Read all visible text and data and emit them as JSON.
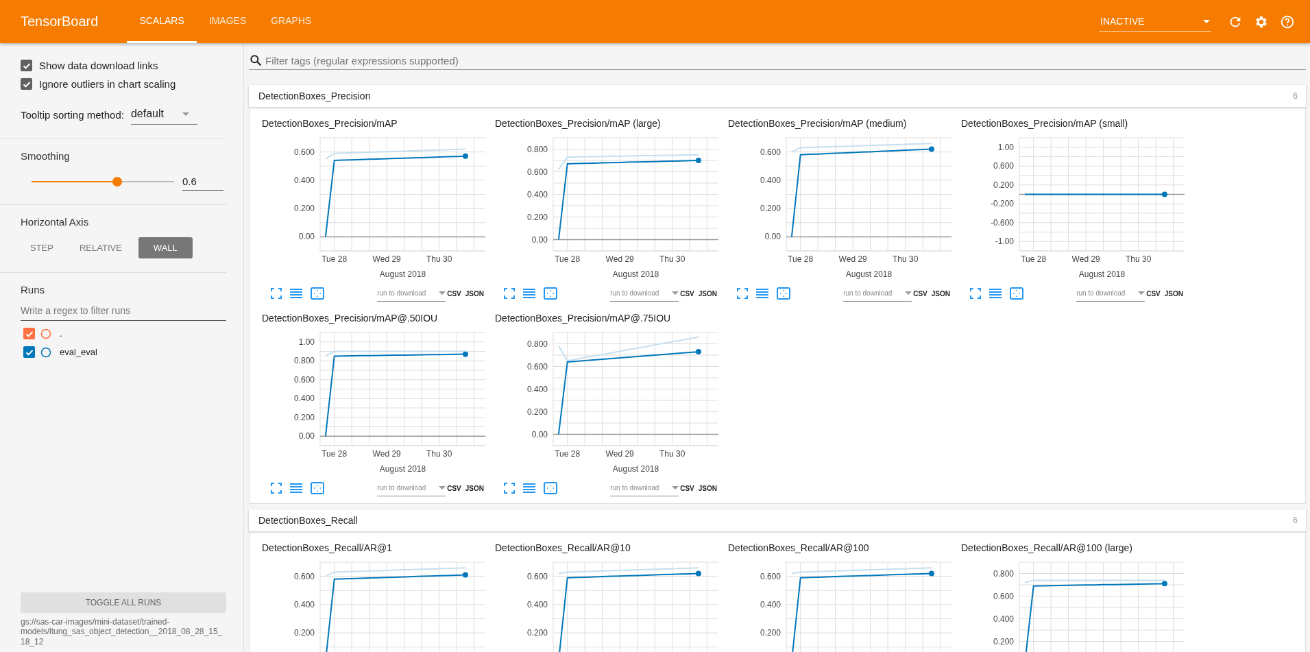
{
  "header": {
    "title": "TensorBoard",
    "tabs": [
      {
        "label": "SCALARS",
        "selected": true
      },
      {
        "label": "IMAGES",
        "selected": false
      },
      {
        "label": "GRAPHS",
        "selected": false
      }
    ],
    "run_status": {
      "value": "INACTIVE"
    }
  },
  "sidebar": {
    "options": [
      {
        "label": "Show data download links",
        "checked": true
      },
      {
        "label": "Ignore outliers in chart scaling",
        "checked": true
      }
    ],
    "tooltip_sorting": {
      "label": "Tooltip sorting method:",
      "value": "default"
    },
    "smoothing": {
      "label": "Smoothing",
      "level": 0.6,
      "reading": "0.6"
    },
    "horizontal_axis": {
      "label": "Horizontal Axis",
      "options": [
        {
          "label": "STEP",
          "selected": false
        },
        {
          "label": "RELATIVE",
          "selected": false
        },
        {
          "label": "WALL",
          "selected": true
        }
      ]
    },
    "runs": {
      "label": "Runs",
      "filter": {
        "placeholder": "Write a regex to filter runs"
      },
      "items": [
        {
          "label": ".",
          "checked": true,
          "color": "#ff7043"
        },
        {
          "label": "eval_eval",
          "checked": true,
          "color": "#0077bb"
        }
      ]
    },
    "toggle_button": "TOGGLE ALL RUNS",
    "log_dir": "gs://sas-car-images/mini-dataset/trained-models/ltung_sas_object_detection__2018_08_28_15_18_12"
  },
  "filter": {
    "placeholder": "Filter tags (regular expressions supported)"
  },
  "sections": [
    {
      "title": "DetectionBoxes_Precision",
      "count": "6",
      "cards": [
        {
          "title": "DetectionBoxes_Precision/mAP",
          "download": {
            "placeholder": "run to download",
            "links": [
              "CSV",
              "JSON"
            ]
          },
          "chart_data": {
            "type": "line",
            "grid": true,
            "xlabel": "August 2018",
            "categories": [
              null,
              "Tue 28",
              null,
              null,
              null,
              null,
              null,
              "Wed 29",
              null,
              null,
              null,
              null,
              null,
              "Thu 30",
              null,
              null,
              null
            ],
            "ylim": [
              -0.1,
              0.7
            ],
            "yticks": [
              {
                "value": 0,
                "label": "0.00"
              },
              {
                "value": 0.2,
                "label": "0.200"
              },
              {
                "value": 0.4,
                "label": "0.400"
              },
              {
                "value": 0.6,
                "label": "0.600"
              }
            ],
            "series": [
              {
                "color": "#c6dff0",
                "values": [
                  0.55,
                  0.59,
                  0.592,
                  0.594,
                  0.596,
                  0.598,
                  0.6,
                  0.602,
                  0.604,
                  0.606,
                  0.608,
                  0.61,
                  0.612,
                  0.614,
                  0.616,
                  0.618,
                  0.62
                ]
              },
              {
                "color": "#0077bb",
                "values": [
                  0,
                  0.54,
                  0.542,
                  0.544,
                  0.546,
                  0.548,
                  0.55,
                  0.552,
                  0.554,
                  0.556,
                  0.558,
                  0.56,
                  0.562,
                  0.564,
                  0.566,
                  0.568,
                  0.57
                ]
              }
            ]
          }
        },
        {
          "title": "DetectionBoxes_Precision/mAP (large)",
          "download": {
            "placeholder": "run to download",
            "links": [
              "CSV",
              "JSON"
            ]
          },
          "chart_data": {
            "type": "line",
            "grid": true,
            "xlabel": "August 2018",
            "categories": [
              null,
              "Tue 28",
              null,
              null,
              null,
              null,
              null,
              "Wed 29",
              null,
              null,
              null,
              null,
              null,
              "Thu 30",
              null,
              null,
              null
            ],
            "ylim": [
              -0.1,
              0.9
            ],
            "yticks": [
              {
                "value": 0,
                "label": "0.00"
              },
              {
                "value": 0.2,
                "label": "0.200"
              },
              {
                "value": 0.4,
                "label": "0.400"
              },
              {
                "value": 0.6,
                "label": "0.600"
              },
              {
                "value": 0.8,
                "label": "0.800"
              }
            ],
            "series": [
              {
                "color": "#c6dff0",
                "values": [
                  0.62,
                  0.73,
                  0.731,
                  0.733,
                  0.734,
                  0.735,
                  0.737,
                  0.738,
                  0.739,
                  0.741,
                  0.742,
                  0.743,
                  0.745,
                  0.746,
                  0.747,
                  0.749,
                  0.75
                ]
              },
              {
                "color": "#0077bb",
                "values": [
                  0,
                  0.67,
                  0.672,
                  0.674,
                  0.676,
                  0.678,
                  0.68,
                  0.682,
                  0.684,
                  0.686,
                  0.688,
                  0.69,
                  0.692,
                  0.694,
                  0.696,
                  0.698,
                  0.7
                ]
              }
            ]
          }
        },
        {
          "title": "DetectionBoxes_Precision/mAP (medium)",
          "download": {
            "placeholder": "run to download",
            "links": [
              "CSV",
              "JSON"
            ]
          },
          "chart_data": {
            "type": "line",
            "grid": true,
            "xlabel": "August 2018",
            "categories": [
              null,
              "Tue 28",
              null,
              null,
              null,
              null,
              null,
              "Wed 29",
              null,
              null,
              null,
              null,
              null,
              "Thu 30",
              null,
              null,
              null
            ],
            "ylim": [
              -0.1,
              0.7
            ],
            "yticks": [
              {
                "value": 0,
                "label": "0.00"
              },
              {
                "value": 0.2,
                "label": "0.200"
              },
              {
                "value": 0.4,
                "label": "0.400"
              },
              {
                "value": 0.6,
                "label": "0.600"
              }
            ],
            "series": [
              {
                "color": "#c6dff0",
                "values": [
                  0.6,
                  0.63,
                  0.632,
                  0.634,
                  0.636,
                  0.638,
                  0.64,
                  0.642,
                  0.644,
                  0.646,
                  0.648,
                  0.65,
                  0.652,
                  0.654,
                  0.656,
                  0.658,
                  0.66
                ]
              },
              {
                "color": "#0077bb",
                "values": [
                  0,
                  0.58,
                  0.583,
                  0.585,
                  0.588,
                  0.591,
                  0.593,
                  0.596,
                  0.599,
                  0.601,
                  0.604,
                  0.607,
                  0.609,
                  0.612,
                  0.615,
                  0.617,
                  0.62
                ]
              }
            ]
          }
        },
        {
          "title": "DetectionBoxes_Precision/mAP (small)",
          "download": {
            "placeholder": "run to download",
            "links": [
              "CSV",
              "JSON"
            ]
          },
          "chart_data": {
            "type": "line",
            "grid": true,
            "xlabel": "August 2018",
            "categories": [
              null,
              "Tue 28",
              null,
              null,
              null,
              null,
              null,
              "Wed 29",
              null,
              null,
              null,
              null,
              null,
              "Thu 30",
              null,
              null,
              null
            ],
            "ylim": [
              -1.2,
              1.2
            ],
            "yticks": [
              {
                "value": -1,
                "label": "-1.00"
              },
              {
                "value": -0.6,
                "label": "-0.600"
              },
              {
                "value": -0.2,
                "label": "-0.200"
              },
              {
                "value": 0.2,
                "label": "0.200"
              },
              {
                "value": 0.6,
                "label": "0.600"
              },
              {
                "value": 1,
                "label": "1.00"
              }
            ],
            "series": [
              {
                "color": "#c6dff0",
                "values": [
                  null,
                  null,
                  null,
                  null,
                  null,
                  null,
                  null,
                  null,
                  null,
                  null,
                  null,
                  null,
                  null,
                  null,
                  null,
                  null,
                  null
                ]
              },
              {
                "color": "#0077bb",
                "values": [
                  0,
                  0,
                  0,
                  0,
                  0,
                  0,
                  0,
                  0,
                  0,
                  0,
                  0,
                  0,
                  0,
                  0,
                  0,
                  0,
                  0
                ]
              }
            ]
          }
        },
        {
          "title": "DetectionBoxes_Precision/mAP@.50IOU",
          "download": {
            "placeholder": "run to download",
            "links": [
              "CSV",
              "JSON"
            ]
          },
          "chart_data": {
            "type": "line",
            "grid": true,
            "xlabel": "August 2018",
            "categories": [
              null,
              "Tue 28",
              null,
              null,
              null,
              null,
              null,
              "Wed 29",
              null,
              null,
              null,
              null,
              null,
              "Thu 30",
              null,
              null,
              null
            ],
            "ylim": [
              -0.1,
              1.1
            ],
            "yticks": [
              {
                "value": 0,
                "label": "0.00"
              },
              {
                "value": 0.2,
                "label": "0.200"
              },
              {
                "value": 0.4,
                "label": "0.400"
              },
              {
                "value": 0.6,
                "label": "0.600"
              },
              {
                "value": 0.8,
                "label": "0.800"
              },
              {
                "value": 1,
                "label": "1.00"
              }
            ],
            "series": [
              {
                "color": "#c6dff0",
                "values": [
                  0.85,
                  0.9,
                  0.9,
                  0.9,
                  0.9,
                  0.9,
                  0.9,
                  0.9,
                  0.9,
                  0.9,
                  0.9,
                  0.9,
                  0.9,
                  0.9,
                  0.9,
                  0.9,
                  0.9
                ]
              },
              {
                "color": "#0077bb",
                "values": [
                  0,
                  0.85,
                  0.851,
                  0.853,
                  0.854,
                  0.855,
                  0.857,
                  0.858,
                  0.859,
                  0.861,
                  0.862,
                  0.863,
                  0.865,
                  0.866,
                  0.867,
                  0.869,
                  0.87
                ]
              }
            ]
          }
        },
        {
          "title": "DetectionBoxes_Precision/mAP@.75IOU",
          "download": {
            "placeholder": "run to download",
            "links": [
              "CSV",
              "JSON"
            ]
          },
          "chart_data": {
            "type": "line",
            "grid": true,
            "xlabel": "August 2018",
            "categories": [
              null,
              "Tue 28",
              null,
              null,
              null,
              null,
              null,
              "Wed 29",
              null,
              null,
              null,
              null,
              null,
              "Thu 30",
              null,
              null,
              null
            ],
            "ylim": [
              -0.1,
              0.9
            ],
            "yticks": [
              {
                "value": 0,
                "label": "0.00"
              },
              {
                "value": 0.2,
                "label": "0.200"
              },
              {
                "value": 0.4,
                "label": "0.400"
              },
              {
                "value": 0.6,
                "label": "0.600"
              },
              {
                "value": 0.8,
                "label": "0.800"
              }
            ],
            "series": [
              {
                "color": "#c6dff0",
                "values": [
                  0.78,
                  0.65,
                  0.664,
                  0.678,
                  0.692,
                  0.706,
                  0.72,
                  0.734,
                  0.748,
                  0.762,
                  0.776,
                  0.79,
                  0.804,
                  0.818,
                  0.832,
                  0.846,
                  0.86
                ]
              },
              {
                "color": "#0077bb",
                "values": [
                  0,
                  0.64,
                  0.646,
                  0.652,
                  0.658,
                  0.664,
                  0.67,
                  0.676,
                  0.682,
                  0.688,
                  0.694,
                  0.7,
                  0.706,
                  0.712,
                  0.718,
                  0.724,
                  0.73
                ]
              }
            ]
          }
        }
      ]
    },
    {
      "title": "DetectionBoxes_Recall",
      "count": "6",
      "cards": [
        {
          "title": "DetectionBoxes_Recall/AR@1",
          "chart_data": {
            "type": "line",
            "grid": true,
            "categories": [
              null,
              null,
              null,
              null,
              null,
              null,
              null,
              null,
              null,
              null,
              null,
              null,
              null,
              null,
              null,
              null,
              null
            ],
            "ylim": [
              -0.1,
              0.7
            ],
            "yticks": [
              {
                "value": 0.2,
                "label": "0.200"
              },
              {
                "value": 0.4,
                "label": "0.400"
              },
              {
                "value": 0.6,
                "label": "0.600"
              }
            ],
            "series": [
              {
                "color": "#c6dff0",
                "values": [
                  0.6,
                  0.63,
                  0.632,
                  0.634,
                  0.636,
                  0.638,
                  0.64,
                  0.642,
                  0.644,
                  0.646,
                  0.648,
                  0.65,
                  0.652,
                  0.654,
                  0.656,
                  0.658,
                  0.66
                ]
              },
              {
                "color": "#0077bb",
                "values": [
                  0,
                  0.58,
                  0.582,
                  0.584,
                  0.586,
                  0.588,
                  0.59,
                  0.592,
                  0.594,
                  0.596,
                  0.598,
                  0.6,
                  0.602,
                  0.604,
                  0.606,
                  0.608,
                  0.61
                ]
              }
            ]
          }
        },
        {
          "title": "DetectionBoxes_Recall/AR@10",
          "chart_data": {
            "type": "line",
            "grid": true,
            "categories": [
              null,
              null,
              null,
              null,
              null,
              null,
              null,
              null,
              null,
              null,
              null,
              null,
              null,
              null,
              null,
              null,
              null
            ],
            "ylim": [
              -0.1,
              0.7
            ],
            "yticks": [
              {
                "value": 0.2,
                "label": "0.200"
              },
              {
                "value": 0.4,
                "label": "0.400"
              },
              {
                "value": 0.6,
                "label": "0.600"
              }
            ],
            "series": [
              {
                "color": "#c6dff0",
                "values": [
                  0.62,
                  0.63,
                  0.632,
                  0.634,
                  0.636,
                  0.638,
                  0.64,
                  0.642,
                  0.644,
                  0.646,
                  0.648,
                  0.65,
                  0.652,
                  0.654,
                  0.656,
                  0.658,
                  0.66
                ]
              },
              {
                "color": "#0077bb",
                "values": [
                  0,
                  0.59,
                  0.592,
                  0.594,
                  0.596,
                  0.598,
                  0.6,
                  0.602,
                  0.604,
                  0.606,
                  0.608,
                  0.61,
                  0.612,
                  0.614,
                  0.616,
                  0.618,
                  0.62
                ]
              }
            ]
          }
        },
        {
          "title": "DetectionBoxes_Recall/AR@100",
          "chart_data": {
            "type": "line",
            "grid": true,
            "categories": [
              null,
              null,
              null,
              null,
              null,
              null,
              null,
              null,
              null,
              null,
              null,
              null,
              null,
              null,
              null,
              null,
              null
            ],
            "ylim": [
              -0.1,
              0.7
            ],
            "yticks": [
              {
                "value": 0.2,
                "label": "0.200"
              },
              {
                "value": 0.4,
                "label": "0.400"
              },
              {
                "value": 0.6,
                "label": "0.600"
              }
            ],
            "series": [
              {
                "color": "#c6dff0",
                "values": [
                  0.62,
                  0.63,
                  0.632,
                  0.634,
                  0.636,
                  0.638,
                  0.64,
                  0.642,
                  0.644,
                  0.646,
                  0.648,
                  0.65,
                  0.652,
                  0.654,
                  0.656,
                  0.658,
                  0.66
                ]
              },
              {
                "color": "#0077bb",
                "values": [
                  0,
                  0.59,
                  0.592,
                  0.594,
                  0.596,
                  0.598,
                  0.6,
                  0.602,
                  0.604,
                  0.606,
                  0.608,
                  0.61,
                  0.612,
                  0.614,
                  0.616,
                  0.618,
                  0.62
                ]
              }
            ]
          }
        },
        {
          "title": "DetectionBoxes_Recall/AR@100 (large)",
          "chart_data": {
            "type": "line",
            "grid": true,
            "categories": [
              null,
              null,
              null,
              null,
              null,
              null,
              null,
              null,
              null,
              null,
              null,
              null,
              null,
              null,
              null,
              null,
              null
            ],
            "ylim": [
              -0.1,
              0.9
            ],
            "yticks": [
              {
                "value": 0.2,
                "label": "0.200"
              },
              {
                "value": 0.4,
                "label": "0.400"
              },
              {
                "value": 0.6,
                "label": "0.600"
              },
              {
                "value": 0.8,
                "label": "0.800"
              }
            ],
            "series": [
              {
                "color": "#c6dff0",
                "values": [
                  0.72,
                  0.74,
                  0.74,
                  0.74,
                  0.74,
                  0.74,
                  0.74,
                  0.74,
                  0.74,
                  0.74,
                  0.74,
                  0.74,
                  0.74,
                  0.74,
                  0.74,
                  0.74,
                  0.74
                ]
              },
              {
                "color": "#0077bb",
                "values": [
                  0,
                  0.69,
                  0.691,
                  0.693,
                  0.694,
                  0.695,
                  0.697,
                  0.698,
                  0.699,
                  0.701,
                  0.702,
                  0.703,
                  0.705,
                  0.706,
                  0.707,
                  0.709,
                  0.71
                ]
              }
            ]
          }
        }
      ]
    }
  ]
}
